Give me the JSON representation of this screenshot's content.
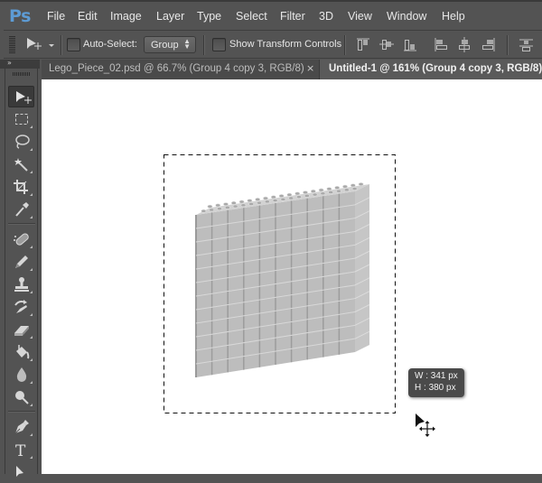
{
  "app": {
    "logo": "Ps",
    "brand_color": "#5d9bd4"
  },
  "menubar": {
    "items": [
      "File",
      "Edit",
      "Image",
      "Layer",
      "Type",
      "Select",
      "Filter",
      "3D",
      "View",
      "Window",
      "Help"
    ]
  },
  "options_bar": {
    "tool_icon": "move-tool-icon",
    "auto_select_label": "Auto-Select:",
    "auto_select_checked": false,
    "auto_select_target": "Group",
    "show_transform_label": "Show Transform Controls",
    "show_transform_checked": false,
    "align_buttons": [
      "align-top-edges",
      "align-vertical-centers",
      "align-bottom-edges",
      "align-left-edges",
      "align-horizontal-centers",
      "align-right-edges",
      "distribute-top-edges"
    ]
  },
  "tabs": [
    {
      "label": "Lego_Piece_02.psd @ 66.7% (Group 4 copy 3, RGB/8)",
      "active": false,
      "close": "×"
    },
    {
      "label": "Untitled-1 @ 161% (Group 4 copy 3, RGB/8) *",
      "active": true
    }
  ],
  "panel_collapse_icon": "»",
  "toolbox": {
    "tools": [
      "move",
      "rectangular-marquee",
      "lasso",
      "magic-wand",
      "crop",
      "eyedropper",
      "spot-healing-brush",
      "brush",
      "clone-stamp",
      "history-brush",
      "eraser",
      "paint-bucket",
      "blur",
      "dodge",
      "pen",
      "type",
      "path-selection"
    ],
    "active_tool": "move"
  },
  "canvas": {
    "background": "#ffffff",
    "content": "lego-brick-wall",
    "wall_columns": 10,
    "wall_rows": 12
  },
  "tooltip": {
    "w_label": "W :",
    "w_value": "341 px",
    "h_label": "H :",
    "h_value": "380 px"
  }
}
